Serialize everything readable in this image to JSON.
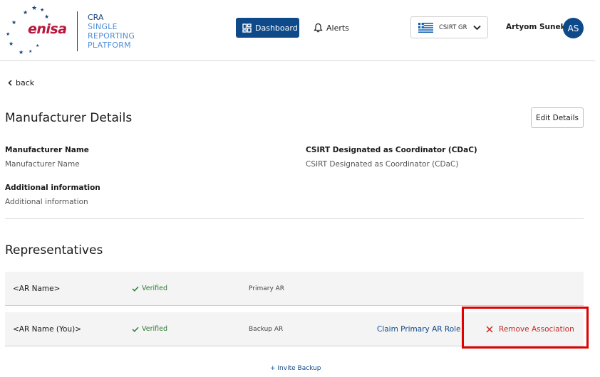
{
  "header": {
    "logo": {
      "word": "enisa",
      "line1": "CRA",
      "line2": "SINGLE",
      "line3": "REPORTING",
      "line4": "PLATFORM"
    },
    "nav": {
      "dashboard": "Dashboard",
      "alerts": "Alerts"
    },
    "csirt_select": "CSIRT GR",
    "user": {
      "name": "Artyom Sunek",
      "initials": "AS"
    }
  },
  "back_label": "back",
  "page_title": "Manufacturer Details",
  "edit_label": "Edit Details",
  "details": {
    "manufacturer_name_label": "Manufacturer Name",
    "manufacturer_name_value": "Manufacturer Name",
    "csirt_label": "CSIRT Designated as Coordinator (CDaC)",
    "csirt_value": "CSIRT Designated as Coordinator (CDaC)",
    "additional_label": "Additional information",
    "additional_value": "Additional information"
  },
  "representatives": {
    "title": "Representatives",
    "rows": [
      {
        "name": "<AR Name>",
        "status": "Verified",
        "role": "Primary AR"
      },
      {
        "name": "<AR Name (You)>",
        "status": "Verified",
        "role": "Backup AR",
        "claim": "Claim Primary AR Role",
        "remove": "Remove Association"
      }
    ]
  },
  "invite_label": "+ Invite Backup",
  "colors": {
    "primary": "#0e4a8a",
    "verified": "#2e7d32",
    "danger": "#c62828",
    "highlight": "#e00000",
    "brand": "#b8163c"
  }
}
